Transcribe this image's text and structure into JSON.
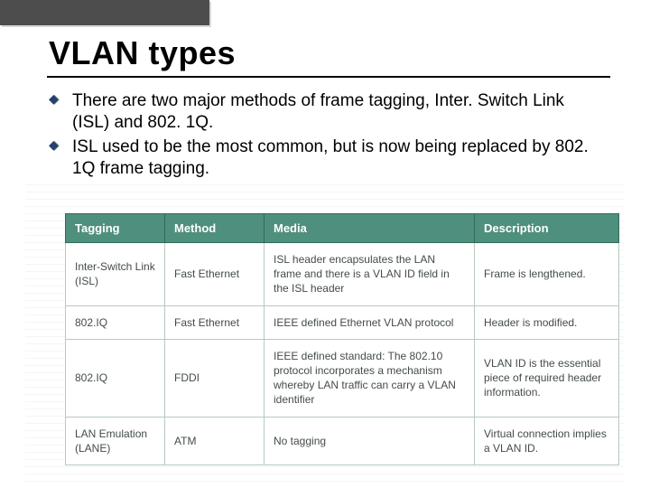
{
  "title": "VLAN types",
  "bullets": [
    "There are two major methods of frame tagging, Inter. Switch Link (ISL) and 802. 1Q.",
    "ISL used to be the most common, but is now being replaced by 802. 1Q frame tagging."
  ],
  "table": {
    "headers": [
      "Tagging",
      "Method",
      "Media",
      "Description"
    ],
    "rows": [
      {
        "tagging": "Inter-Switch Link (ISL)",
        "method": "Fast Ethernet",
        "media": "ISL header encapsulates the LAN frame and there is a VLAN ID field in the ISL header",
        "description": "Frame is lengthened."
      },
      {
        "tagging": "802.IQ",
        "method": "Fast Ethernet",
        "media": "IEEE defined Ethernet VLAN protocol",
        "description": "Header is modified."
      },
      {
        "tagging": "802.IQ",
        "method": "FDDI",
        "media": "IEEE defined standard: The 802.10 protocol incorporates a mechanism whereby LAN traffic can carry a VLAN identifier",
        "description": "VLAN ID is the essential piece of required header information."
      },
      {
        "tagging": "LAN Emulation (LANE)",
        "method": "ATM",
        "media": "No tagging",
        "description": "Virtual connection implies a VLAN ID."
      }
    ]
  },
  "chart_data": {
    "type": "table",
    "title": "VLAN frame tagging methods",
    "columns": [
      "Tagging",
      "Method",
      "Media",
      "Description"
    ],
    "rows": [
      [
        "Inter-Switch Link (ISL)",
        "Fast Ethernet",
        "ISL header encapsulates the LAN frame and there is a VLAN ID field in the ISL header",
        "Frame is lengthened."
      ],
      [
        "802.IQ",
        "Fast Ethernet",
        "IEEE defined Ethernet VLAN protocol",
        "Header is modified."
      ],
      [
        "802.IQ",
        "FDDI",
        "IEEE defined standard: The 802.10 protocol incorporates a mechanism whereby LAN traffic can carry a VLAN identifier",
        "VLAN ID is the essential piece of required header information."
      ],
      [
        "LAN Emulation (LANE)",
        "ATM",
        "No tagging",
        "Virtual connection implies a VLAN ID."
      ]
    ]
  }
}
